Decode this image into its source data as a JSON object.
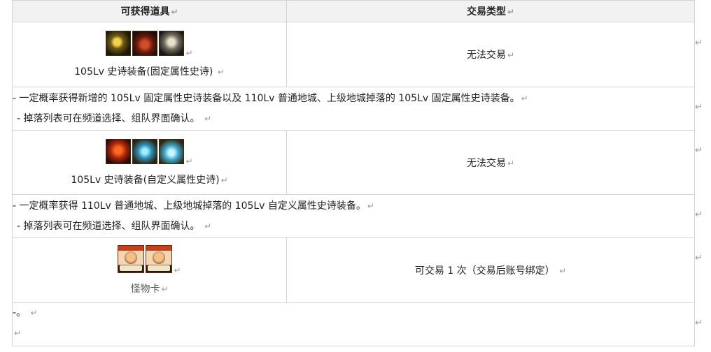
{
  "header": {
    "col_item": "可获得道具",
    "col_trade": "交易类型"
  },
  "return_mark": "↵",
  "rows": [
    {
      "item_name": "105Lv 史诗装备(固定属性史诗)",
      "icons": [
        "glove-icon",
        "boots-icon",
        "gauntlet-icon"
      ],
      "trade": "无法交易",
      "desc_lines": [
        "- 一定概率获得新增的 105Lv 固定属性史诗装备以及 110Lv 普通地城、上级地城掉落的 105Lv 固定属性史诗装备。",
        "  - 掉落列表可在频道选择、组队界面确认。"
      ]
    },
    {
      "item_name": "105Lv 史诗装备(自定义属性史诗)",
      "icons": [
        "hood-icon",
        "necklace-icon",
        "ring-icon"
      ],
      "trade": "无法交易",
      "desc_lines": [
        "- 一定概率获得 110Lv 普通地城、上级地城掉落的 105Lv 自定义属性史诗装备。",
        "  - 掉落列表可在频道选择、组队界面确认。"
      ]
    },
    {
      "item_name": "怪物卡",
      "icons": [
        "monster-card-icon",
        "monster-card-icon"
      ],
      "trade": "可交易 1 次（交易后账号绑定）",
      "desc_lines": [
        "-。"
      ]
    }
  ]
}
